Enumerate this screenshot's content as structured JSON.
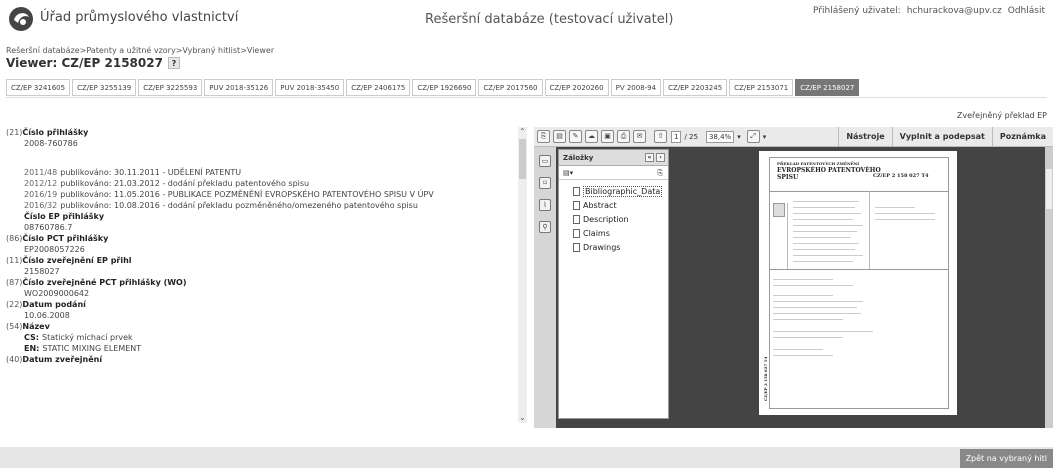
{
  "header": {
    "org_name": "Úřad průmyslového vlastnictví",
    "app_title": "Rešeršní databáze (testovací uživatel)",
    "user_label": "Přihlášený uživatel:",
    "user_email": "hchurackova@upv.cz",
    "logout": "Odhlásit"
  },
  "breadcrumb": [
    "Rešeršní databáze",
    ">Patenty a užitné vzory",
    ">Vybraný hitlist",
    ">Viewer"
  ],
  "viewer_title": "Viewer: CZ/EP 2158027",
  "help_label": "?",
  "tabs": [
    {
      "label": "CZ/EP 3241605"
    },
    {
      "label": "CZ/EP 3255139"
    },
    {
      "label": "CZ/EP 3225593"
    },
    {
      "label": "PUV 2018-35126"
    },
    {
      "label": "PUV 2018-35450"
    },
    {
      "label": "CZ/EP 2406175"
    },
    {
      "label": "CZ/EP 1926690"
    },
    {
      "label": "CZ/EP 2017560"
    },
    {
      "label": "CZ/EP 2020260"
    },
    {
      "label": "PV 2008-94"
    },
    {
      "label": "CZ/EP 2203245"
    },
    {
      "label": "CZ/EP 2153071"
    },
    {
      "label": "CZ/EP 2158027",
      "active": true
    }
  ],
  "translation_link": "Zveřejněný překlad EP",
  "info": {
    "f21_code": "(21)",
    "f21_label": "Číslo přihlášky",
    "f21_value": "2008-760786",
    "publications": [
      {
        "yr": "2011/48",
        "text": "publikováno: 30.11.2011 - UDĚLENÍ PATENTU"
      },
      {
        "yr": "2012/12",
        "text": "publikováno: 21.03.2012 - dodání překladu patentového spisu"
      },
      {
        "yr": "2016/19",
        "text": "publikováno: 11.05.2016 - PUBLIKACE POZMĚNĚNÍ EVROPSKÉHO PATENTOVÉHO SPISU V ÚPV"
      },
      {
        "yr": "2016/32",
        "text": "publikováno: 10.08.2016 - dodání překladu pozměněného/omezeného patentového spisu"
      }
    ],
    "ep_label": "Číslo EP přihlášky",
    "ep_value": "08760786.7",
    "f86_code": "(86)",
    "f86_label": "Číslo PCT přihlášky",
    "f86_value": "EP2008057226",
    "f11_code": "(11)",
    "f11_label": "Číslo zveřejnění EP přihl",
    "f11_value": "2158027",
    "f87_code": "(87)",
    "f87_label": "Číslo zveřejněné PCT přihlášky (WO)",
    "f87_value": "WO2009000642",
    "f22_code": "(22)",
    "f22_label": "Datum podání",
    "f22_value": "10.06.2008",
    "f54_code": "(54)",
    "f54_label": "Název",
    "name_cs_key": "CS:",
    "name_cs": "Statický míchací prvek",
    "name_en_key": "EN:",
    "name_en": "STATIC MIXING ELEMENT",
    "f40_code": "(40)",
    "f40_label": "Datum zveřejnění"
  },
  "pdf": {
    "page_current": "1",
    "page_total": "/ 25",
    "zoom": "38,4%",
    "btn_tools": "Nástroje",
    "btn_sign": "Vyplnit a podepsat",
    "btn_comment": "Poznámka",
    "bookmarks_title": "Záložky",
    "bookmarks": [
      {
        "label": "Bibliographic_Data",
        "selected": true
      },
      {
        "label": "Abstract"
      },
      {
        "label": "Description"
      },
      {
        "label": "Claims"
      },
      {
        "label": "Drawings"
      }
    ],
    "page_title_small": "PŘEKLAD PATENTOVÝCH ZMĚNĚNÍ",
    "page_title_1": "EVROPSKÉHO PATENTOVÉHO",
    "page_title_2": "SPISU",
    "page_number": "CZ/EP 2 158 027 T4",
    "page_vertical": "CZ/EP 2 158 027 T4"
  },
  "footer": {
    "back_button": "Zpět na vybraný hitl"
  }
}
